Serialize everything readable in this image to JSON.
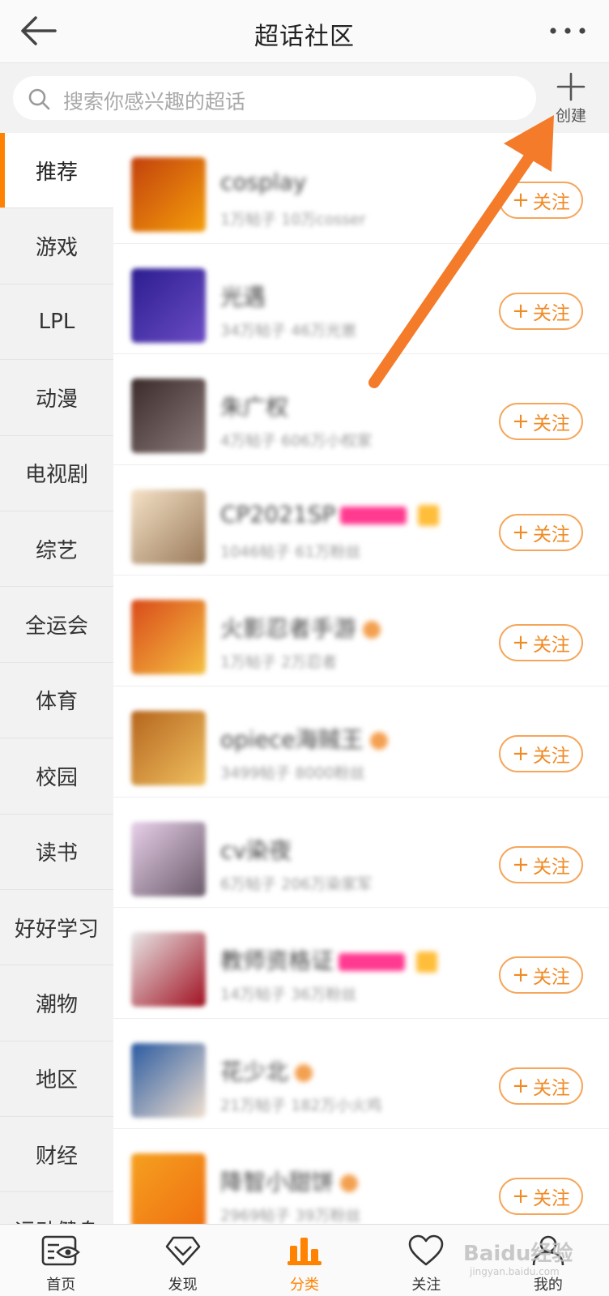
{
  "header": {
    "title": "超话社区"
  },
  "search": {
    "placeholder": "搜索你感兴趣的超话",
    "create_label": "创建"
  },
  "sidebar": {
    "items": [
      {
        "label": "推荐",
        "active": true
      },
      {
        "label": "游戏"
      },
      {
        "label": "LPL"
      },
      {
        "label": "动漫"
      },
      {
        "label": "电视剧"
      },
      {
        "label": "综艺"
      },
      {
        "label": "全运会"
      },
      {
        "label": "体育"
      },
      {
        "label": "校园"
      },
      {
        "label": "读书"
      },
      {
        "label": "好好学习"
      },
      {
        "label": "潮物"
      },
      {
        "label": "地区"
      },
      {
        "label": "财经"
      },
      {
        "label": "运动健身"
      }
    ]
  },
  "topics": [
    {
      "name": "cosplay",
      "meta": "1万帖子 10万cosser",
      "colors": [
        "#c2410c",
        "#f59e0b"
      ]
    },
    {
      "name": "光遇",
      "meta": "34万帖子 46万光崽",
      "colors": [
        "#2b1d8f",
        "#6b4cc4"
      ]
    },
    {
      "name": "朱广权",
      "meta": "4万帖子 606万小权家",
      "colors": [
        "#3a2a2a",
        "#8a7a7a"
      ]
    },
    {
      "name": "CP2021SP",
      "meta": "1046帖子 61万粉丝",
      "colors": [
        "#f5e2c8",
        "#9a7a5a"
      ],
      "badges": [
        "pink",
        "orange"
      ]
    },
    {
      "name": "火影忍者手游",
      "meta": "1万帖子 2万忍者",
      "colors": [
        "#d94a1a",
        "#f5c040"
      ],
      "badges": [
        "v"
      ]
    },
    {
      "name": "opiece海贼王",
      "meta": "3499帖子 8000粉丝",
      "colors": [
        "#b5651d",
        "#f0c060"
      ],
      "badges": [
        "v"
      ]
    },
    {
      "name": "cv染夜",
      "meta": "6万帖子 206万染家军",
      "colors": [
        "#e8d0ea",
        "#6a5a6a"
      ]
    },
    {
      "name": "教师资格证",
      "meta": "14万帖子 36万粉丝",
      "colors": [
        "#e8e8e8",
        "#a01020"
      ],
      "badges": [
        "pink",
        "orange"
      ]
    },
    {
      "name": "花少北",
      "meta": "21万帖子 182万小火鸡",
      "colors": [
        "#2a5aa0",
        "#f0e0d0"
      ],
      "badges": [
        "v"
      ]
    },
    {
      "name": "降智小甜饼",
      "meta": "2969帖子 39万粉丝",
      "colors": [
        "#f5a020",
        "#f07010"
      ],
      "badges": [
        "v"
      ]
    }
  ],
  "follow_label": "关注",
  "tabbar": [
    {
      "label": "首页",
      "icon": "home-eye-icon"
    },
    {
      "label": "发现",
      "icon": "discover-diamond-icon"
    },
    {
      "label": "分类",
      "icon": "category-bars-icon",
      "active": true
    },
    {
      "label": "关注",
      "icon": "heart-icon"
    },
    {
      "label": "我的",
      "icon": "person-icon"
    }
  ],
  "watermark": {
    "text": "Baidu经验",
    "sub": "jingyan.baidu.com"
  },
  "colors": {
    "accent": "#ff8200",
    "follow_border": "#f5a65b",
    "annotation_arrow": "#f47b2a"
  }
}
